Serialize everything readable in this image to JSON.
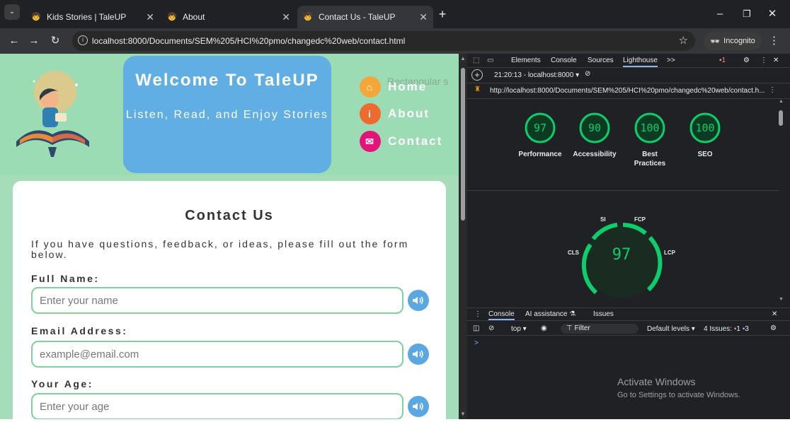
{
  "browser": {
    "tabs": [
      {
        "title": "Kids Stories | TaleUP",
        "active": false
      },
      {
        "title": "About",
        "active": false
      },
      {
        "title": "Contact Us - TaleUP",
        "active": true
      }
    ],
    "url": "localhost:8000/Documents/SEM%205/HCI%20pmo/changedc%20web/contact.html",
    "incognito_label": "Incognito"
  },
  "page": {
    "welcome_title": "Welcome To TaleUP",
    "welcome_subtitle": "Listen, Read, and Enjoy Stories",
    "nav": [
      {
        "label": "Home",
        "color": "#f4a63a"
      },
      {
        "label": "About",
        "color": "#ef6a2f"
      },
      {
        "label": "Contact",
        "color": "#e5127a"
      }
    ],
    "ghost_text": "Rectangular s",
    "contact_title": "Contact Us",
    "intro": "If you have questions, feedback, or ideas, please fill out the form below.",
    "fields": [
      {
        "label": "Full Name:",
        "placeholder": "Enter your name"
      },
      {
        "label": "Email Address:",
        "placeholder": "example@email.com"
      },
      {
        "label": "Your Age:",
        "placeholder": "Enter your age"
      }
    ]
  },
  "devtools": {
    "tabs": [
      "Elements",
      "Console",
      "Sources",
      "Lighthouse"
    ],
    "more": ">>",
    "issue_count": "1",
    "report_time": "21:20:13 - localhost:8000",
    "report_url": "http://localhost:8000/Documents/SEM%205/HCI%20pmo/changedc%20web/contact.h...",
    "scores": [
      {
        "label": "Performance",
        "value": 97
      },
      {
        "label": "Accessibility",
        "value": 90
      },
      {
        "label": "Best Practices",
        "value": 100
      },
      {
        "label": "SEO",
        "value": 100
      }
    ],
    "metric_labels": [
      "SI",
      "FCP",
      "LCP",
      "CLS"
    ],
    "big_score": 97,
    "drawer_tabs": [
      "Console",
      "AI assistance",
      "Issues"
    ],
    "console_context": "top",
    "filter_placeholder": "Filter",
    "default_levels": "Default levels",
    "issues_label": "4 Issues:",
    "issues_errors": "1",
    "issues_info": "3",
    "prompt": ">",
    "activate_title": "Activate Windows",
    "activate_sub": "Go to Settings to activate Windows."
  },
  "colors": {
    "accent_green": "#0cce6b",
    "header_green": "#9cdcb4",
    "welcome_blue": "#60aee3"
  }
}
